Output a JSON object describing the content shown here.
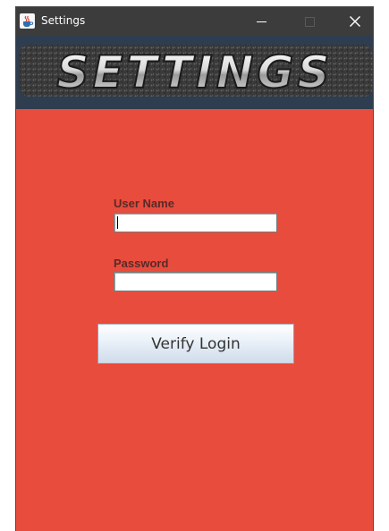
{
  "window": {
    "title": "Settings",
    "icon": "java-cup-icon",
    "controls": {
      "minimize": "—",
      "maximize": "□",
      "close": "✕"
    }
  },
  "banner": {
    "text": "SETTINGS"
  },
  "form": {
    "username_label": "User Name",
    "username_value": "",
    "password_label": "Password",
    "password_value": "",
    "verify_button": "Verify Login"
  },
  "colors": {
    "background": "#e84c3d",
    "banner": "#2e3d4f",
    "label": "#5a2a26"
  }
}
